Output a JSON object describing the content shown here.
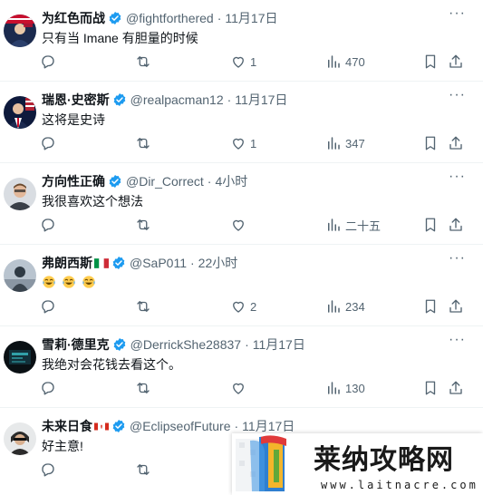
{
  "colors": {
    "text": "#0f1419",
    "muted": "#536471",
    "verified": "#1d9bf0",
    "divider": "#eff3f4"
  },
  "icons": {
    "reply": "reply-icon",
    "retweet": "retweet-icon",
    "like": "heart-icon",
    "views": "views-icon",
    "bookmark": "bookmark-icon",
    "share": "share-icon",
    "verified": "verified-badge-icon",
    "more": "more-icon"
  },
  "tweets": [
    {
      "name": "为红色而战",
      "handle": "@fightforthered",
      "dot": "·",
      "time": "11月17日",
      "text": "只有当 Imane 有胆量的时候",
      "replies": "",
      "retweets": "",
      "likes": "1",
      "views": "470"
    },
    {
      "name": "瑞恩·史密斯",
      "handle": "@realpacman12",
      "dot": "·",
      "time": "11月17日",
      "text": "这将是史诗",
      "replies": "",
      "retweets": "",
      "likes": "1",
      "views": "347"
    },
    {
      "name": "方向性正确",
      "handle": "@Dir_Correct",
      "dot": "·",
      "time": "4小时",
      "text": "我很喜欢这个想法",
      "replies": "",
      "retweets": "",
      "likes": "",
      "views": "二十五"
    },
    {
      "name": "弗朗西斯",
      "flag": "italy-flag",
      "handle": "@SaP011",
      "dot": "·",
      "time": "22小时",
      "text": "",
      "emoji": "laughing-tears-emoji",
      "replies": "",
      "retweets": "",
      "likes": "2",
      "views": "234"
    },
    {
      "name": "雪莉·德里克",
      "handle": "@DerrickShe28837",
      "dot": "·",
      "time": "11月17日",
      "text": "我绝对会花钱去看这个。",
      "replies": "",
      "retweets": "",
      "likes": "",
      "views": "130"
    },
    {
      "name": "未来日食",
      "flag": "canada-flag",
      "handle": "@EclipseofFuture",
      "dot": "·",
      "time": "11月17日",
      "text": "好主意!",
      "replies": "",
      "retweets": "",
      "likes": "",
      "views": ""
    }
  ],
  "watermark": {
    "name": "莱纳攻略网",
    "url": "www.laitnacre.com"
  }
}
